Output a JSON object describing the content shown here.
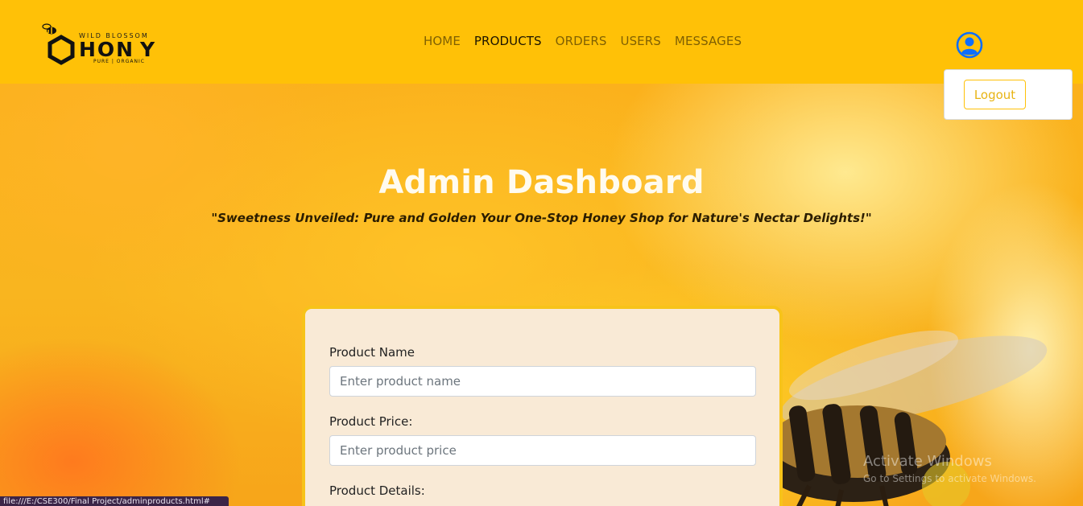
{
  "brand": {
    "top_line": "WILD BLOSSOM",
    "word_left": "HON",
    "word_right": "Y",
    "tagline": "PURE | ORGANIC"
  },
  "nav": {
    "items": [
      {
        "label": "HOME",
        "active": false
      },
      {
        "label": "PRODUCTS",
        "active": true
      },
      {
        "label": "ORDERS",
        "active": false
      },
      {
        "label": "USERS",
        "active": false
      },
      {
        "label": "MESSAGES",
        "active": false
      }
    ]
  },
  "user_menu": {
    "icon": "user-circle-icon",
    "logout_label": "Logout"
  },
  "hero": {
    "title": "Admin Dashboard",
    "tagline": "\"Sweetness Unveiled: Pure and Golden Your One-Stop Honey Shop for Nature's Nectar Delights!\""
  },
  "form": {
    "name_label": "Product Name",
    "name_placeholder": "Enter product name",
    "price_label": "Product Price:",
    "price_placeholder": "Enter product price",
    "details_label": "Product Details:"
  },
  "status_bar": {
    "url": "file:///E:/CSE300/Final Project/adminproducts.html#"
  },
  "watermark": {
    "title": "Activate Windows",
    "subtitle": "Go to Settings to activate Windows."
  },
  "colors": {
    "header": "#ffc107",
    "accent": "#ffc107",
    "card_bg": "#f9ead6",
    "card_border": "#f7c31a",
    "user_icon": "#0d6efd"
  }
}
